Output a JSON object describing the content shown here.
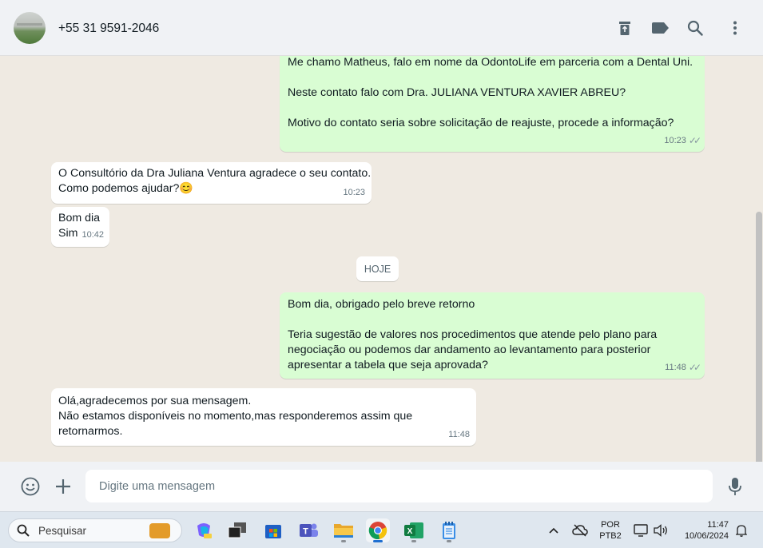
{
  "header": {
    "contact_name": "+55 31 9591-2046",
    "icons": [
      "delete-icon",
      "label-icon",
      "search-icon",
      "more-menu-icon"
    ]
  },
  "messages": [
    {
      "direction": "out",
      "lines": [
        "Me chamo Matheus, falo em nome da OdontoLife em parceria com a Dental Uni.",
        "",
        "Neste contato falo com Dra. JULIANA VENTURA XAVIER ABREU?",
        "",
        "Motivo do contato seria sobre solicitação de reajuste, procede a informação?"
      ],
      "time": "10:23",
      "read": true
    },
    {
      "direction": "in",
      "lines": [
        "O Consultório da Dra Juliana Ventura agradece o seu contato.",
        "Como podemos ajudar?"
      ],
      "emoji": "😊",
      "time": "10:23"
    },
    {
      "direction": "in",
      "lines": [
        "Bom dia",
        "Sim"
      ],
      "time": "10:42"
    },
    {
      "direction": "out",
      "lines": [
        "Bom dia, obrigado pelo breve retorno",
        "",
        "Teria sugestão de valores nos procedimentos que atende pelo plano para",
        "negociação ou podemos dar andamento ao levantamento para posterior",
        "apresentar a tabela que seja aprovada?"
      ],
      "time": "11:48",
      "read": true
    },
    {
      "direction": "in",
      "lines": [
        "Olá,agradecemos por sua mensagem.",
        "Não estamos disponíveis no momento,mas responderemos assim que",
        "retornarmos."
      ],
      "time": "11:48"
    }
  ],
  "date_divider": "HOJE",
  "composer": {
    "placeholder": "Digite uma mensagem",
    "icons": [
      "emoji-icon",
      "attach-plus-icon",
      "microphone-icon"
    ]
  },
  "taskbar": {
    "search_label": "Pesquisar",
    "apps": [
      "copilot-icon",
      "task-view-icon",
      "microsoft-store-icon",
      "teams-icon",
      "file-explorer-icon",
      "chrome-icon",
      "excel-icon",
      "notepad-icon"
    ],
    "language": "POR",
    "keyboard": "PTB2",
    "time": "11:47",
    "date": "10/06/2024"
  },
  "colors": {
    "outgoing_bubble": "#d9fdd3",
    "incoming_bubble": "#ffffff",
    "chat_background": "#efeae2",
    "panel": "#f0f2f5"
  }
}
